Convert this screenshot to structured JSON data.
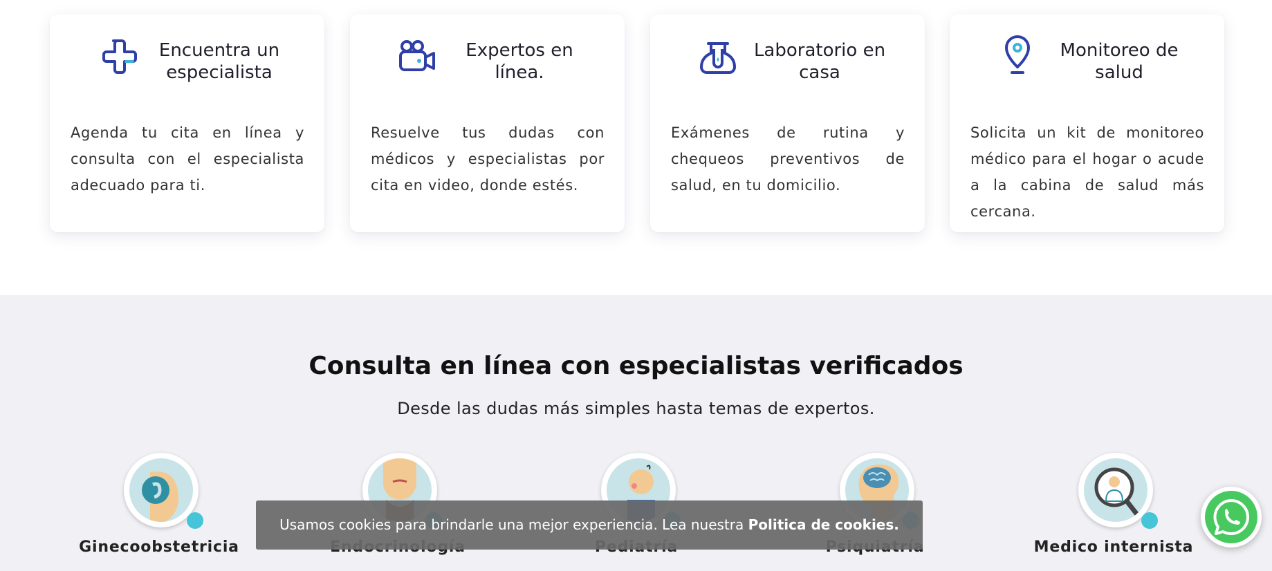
{
  "cards": [
    {
      "icon": "cross-plus-icon",
      "title": "Encuentra un especialista",
      "text": "Agenda tu cita en línea y consulta con el especialista adecuado para ti."
    },
    {
      "icon": "video-camera-icon",
      "title": "Expertos en línea.",
      "text": "Resuelve tus dudas con médicos y especialistas por cita en video, donde estés."
    },
    {
      "icon": "lab-flask-icon",
      "title": "Laboratorio en casa",
      "text": "Exámenes de rutina y chequeos preventivos de salud, en tu domicilio."
    },
    {
      "icon": "location-pin-icon",
      "title": "Monitoreo de salud",
      "text": "Solicita un kit de monitoreo médico para el hogar o acude a la cabina de salud más cercana."
    }
  ],
  "specialists_section": {
    "title": "Consulta en línea con especialistas verificados",
    "subtitle": "Desde las dudas más simples hasta temas de expertos.",
    "items": [
      {
        "label": "Ginecoobstetricia",
        "icon": "pregnancy-icon"
      },
      {
        "label": "Endocrinología",
        "icon": "thyroid-icon"
      },
      {
        "label": "Pediatría",
        "icon": "baby-icon"
      },
      {
        "label": "Psiquiatría",
        "icon": "brain-icon"
      },
      {
        "label": "Medico internista",
        "icon": "doctor-magnifier-icon"
      }
    ]
  },
  "cookie_banner": {
    "text": "Usamos cookies para brindarle una mejor experiencia. Lea nuestra ",
    "link": "Politica de cookies."
  },
  "whatsapp": {
    "icon": "whatsapp-icon"
  },
  "colors": {
    "icon_blue": "#2f3fa8",
    "icon_accent": "#3bb4d8",
    "section_bg": "#f0f0f5",
    "dot": "#46c4d8",
    "whatsapp_green": "#48c95f"
  }
}
